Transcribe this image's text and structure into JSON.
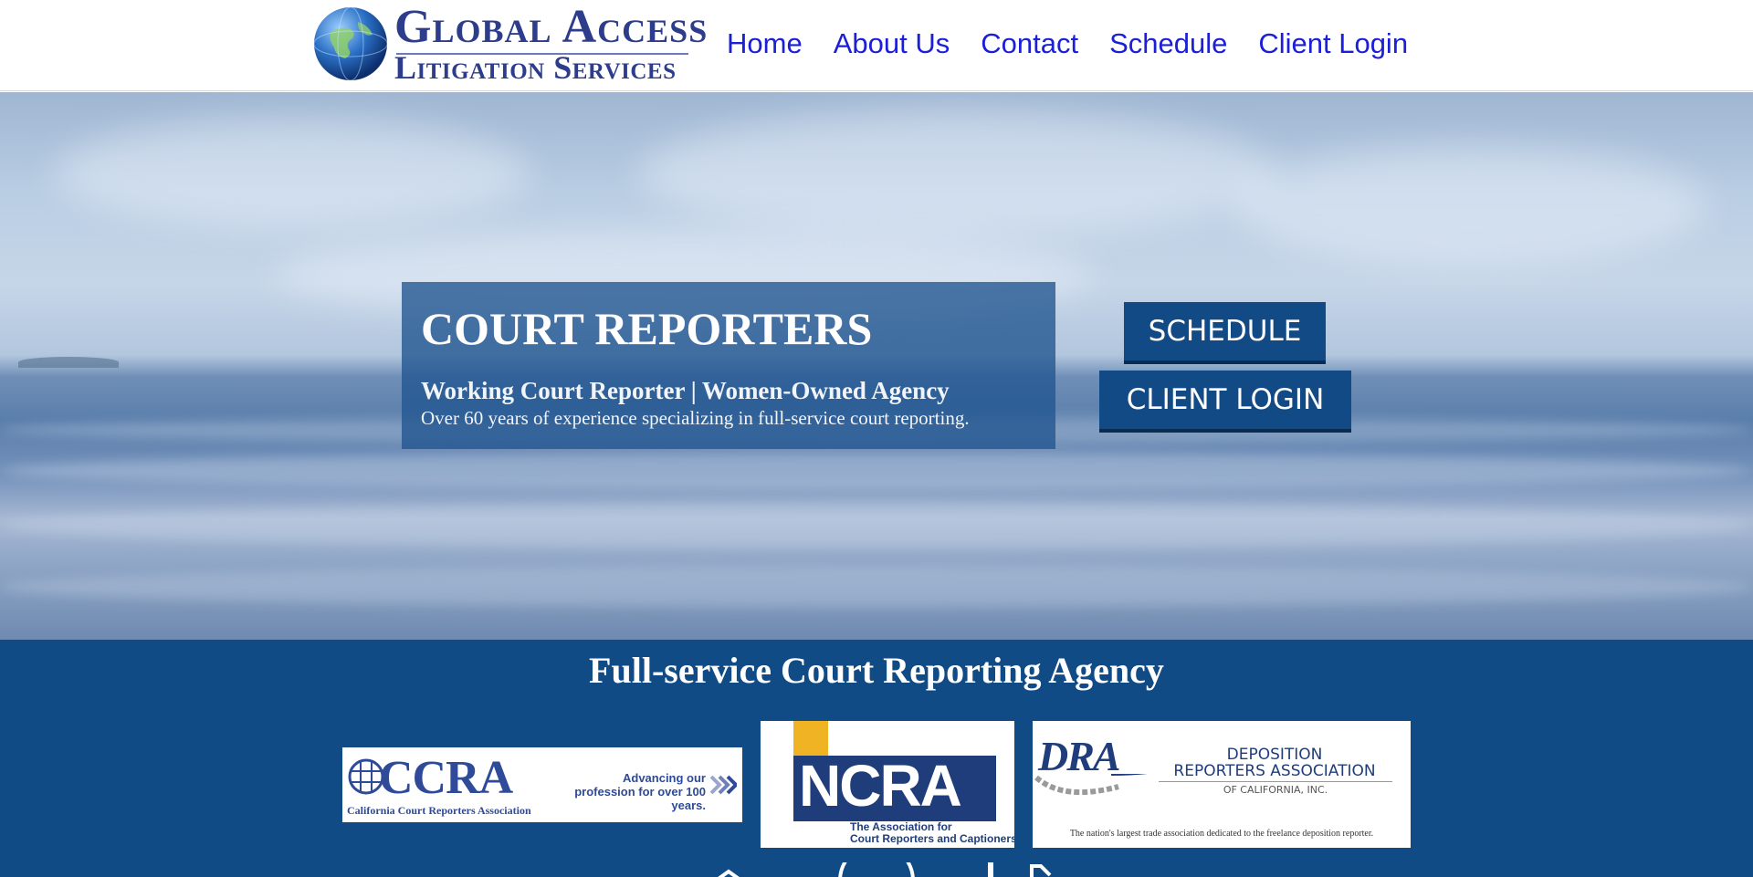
{
  "header": {
    "logo": {
      "line1": "Global Access",
      "line2": "Litigation Services"
    },
    "nav": [
      "Home",
      "About Us",
      "Contact",
      "Schedule",
      "Client Login"
    ]
  },
  "hero": {
    "title": "COURT REPORTERS",
    "subtitle": "Working Court Reporter | Women-Owned Agency",
    "description": "Over 60 years of experience specializing in full-service court reporting.",
    "buttons": {
      "schedule": "SCHEDULE",
      "client_login": "CLIENT LOGIN"
    }
  },
  "band": {
    "title": "Full-service Court Reporting Agency",
    "badges": {
      "ccra": {
        "mark": "CCRA",
        "full": "California Court Reporters Association",
        "tagline": "Advancing our profession for over 100 years."
      },
      "ncra": {
        "mark": "NCRA",
        "sub1": "The Association for",
        "sub2": "Court Reporters and Captioners"
      },
      "dra": {
        "mark": "DRA",
        "name1": "DEPOSITION",
        "name2": "REPORTERS ASSOCIATION",
        "inc": "OF CALIFORNIA, INC.",
        "footer": "The nation's largest trade association dedicated to the freelance deposition reporter."
      }
    }
  },
  "colors": {
    "nav_link": "#1b20d6",
    "band": "#104b86",
    "button": "#124a86"
  }
}
